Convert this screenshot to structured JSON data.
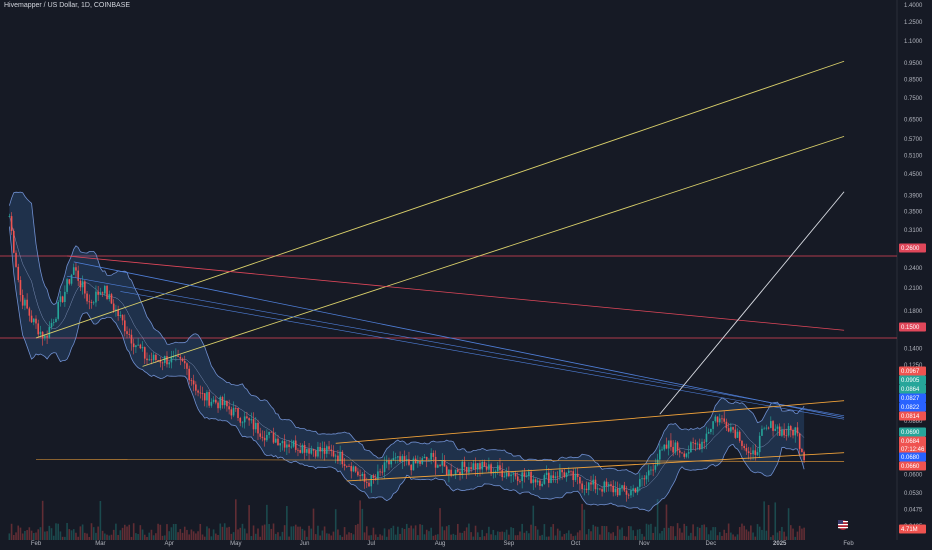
{
  "header": {
    "title": "Hivemapper / US Dollar, 1D, COINBASE"
  },
  "colors": {
    "background": "#161a25",
    "up": "#26a69a",
    "down": "#ef5350",
    "band_fill": "#3b6fb0",
    "band_line": "#6f8fd0",
    "trend_yellow": "#d9cf6a",
    "trend_orange": "#f0a23a",
    "trend_blue": "#4f7fd8",
    "trend_red": "#e0475a",
    "trend_white": "#d8dbe2",
    "axis_text": "#b2b5be"
  },
  "chart_data": {
    "type": "candlestick",
    "title": "Hivemapper / US Dollar, 1D, COINBASE",
    "y_scale": "log",
    "y_ticks": [
      "1.4000",
      "1.2500",
      "1.1000",
      "0.9500",
      "0.8500",
      "0.7500",
      "0.6500",
      "0.5700",
      "0.5100",
      "0.4500",
      "0.3900",
      "0.3500",
      "0.3100",
      "0.2700",
      "0.2400",
      "0.2100",
      "0.1800",
      "0.1600",
      "0.1400",
      "0.1250",
      "0.1100",
      "0.0960",
      "0.0860",
      "0.0760",
      "0.0680",
      "0.0600",
      "0.0530",
      "0.0475",
      "0.0425"
    ],
    "x_ticks": [
      "Feb",
      "Mar",
      "Apr",
      "May",
      "Jun",
      "Jul",
      "Aug",
      "Sep",
      "Oct",
      "Nov",
      "Dec",
      "2025",
      "Feb"
    ],
    "price_path": [
      {
        "date": "2024-01-20",
        "price": 0.34
      },
      {
        "date": "2024-01-25",
        "price": 0.2
      },
      {
        "date": "2024-01-30",
        "price": 0.17
      },
      {
        "date": "2024-02-05",
        "price": 0.15
      },
      {
        "date": "2024-02-12",
        "price": 0.19
      },
      {
        "date": "2024-02-18",
        "price": 0.24
      },
      {
        "date": "2024-02-25",
        "price": 0.19
      },
      {
        "date": "2024-03-02",
        "price": 0.21
      },
      {
        "date": "2024-03-08",
        "price": 0.18
      },
      {
        "date": "2024-03-15",
        "price": 0.15
      },
      {
        "date": "2024-03-22",
        "price": 0.13
      },
      {
        "date": "2024-04-01",
        "price": 0.13
      },
      {
        "date": "2024-04-08",
        "price": 0.125
      },
      {
        "date": "2024-04-15",
        "price": 0.102
      },
      {
        "date": "2024-04-25",
        "price": 0.096
      },
      {
        "date": "2024-05-05",
        "price": 0.087
      },
      {
        "date": "2024-05-15",
        "price": 0.078
      },
      {
        "date": "2024-05-25",
        "price": 0.074
      },
      {
        "date": "2024-06-05",
        "price": 0.071
      },
      {
        "date": "2024-06-15",
        "price": 0.069
      },
      {
        "date": "2024-06-22",
        "price": 0.064
      },
      {
        "date": "2024-06-28",
        "price": 0.057
      },
      {
        "date": "2024-07-03",
        "price": 0.058
      },
      {
        "date": "2024-07-10",
        "price": 0.066
      },
      {
        "date": "2024-07-20",
        "price": 0.064
      },
      {
        "date": "2024-07-28",
        "price": 0.067
      },
      {
        "date": "2024-08-05",
        "price": 0.061
      },
      {
        "date": "2024-08-15",
        "price": 0.064
      },
      {
        "date": "2024-08-25",
        "price": 0.062
      },
      {
        "date": "2024-09-05",
        "price": 0.06
      },
      {
        "date": "2024-09-15",
        "price": 0.058
      },
      {
        "date": "2024-09-25",
        "price": 0.061
      },
      {
        "date": "2024-10-05",
        "price": 0.056
      },
      {
        "date": "2024-10-15",
        "price": 0.055
      },
      {
        "date": "2024-10-25",
        "price": 0.053
      },
      {
        "date": "2024-11-01",
        "price": 0.058
      },
      {
        "date": "2024-11-06",
        "price": 0.066
      },
      {
        "date": "2024-11-12",
        "price": 0.073
      },
      {
        "date": "2024-11-20",
        "price": 0.07
      },
      {
        "date": "2024-11-27",
        "price": 0.075
      },
      {
        "date": "2024-12-03",
        "price": 0.088
      },
      {
        "date": "2024-12-08",
        "price": 0.085
      },
      {
        "date": "2024-12-14",
        "price": 0.078
      },
      {
        "date": "2024-12-19",
        "price": 0.066
      },
      {
        "date": "2024-12-24",
        "price": 0.078
      },
      {
        "date": "2024-12-29",
        "price": 0.084
      },
      {
        "date": "2025-01-03",
        "price": 0.079
      },
      {
        "date": "2025-01-08",
        "price": 0.081
      },
      {
        "date": "2025-01-12",
        "price": 0.0684
      }
    ],
    "price_labels": [
      {
        "text": "0.2600",
        "color": "#e0475a"
      },
      {
        "text": "0.1500",
        "color": "#e0475a"
      },
      {
        "text": "0.0967",
        "color": "#ef5350"
      },
      {
        "text": "0.0905",
        "color": "#26a69a"
      },
      {
        "text": "0.0864",
        "color": "#26a69a"
      },
      {
        "text": "0.0827",
        "color": "#2962ff"
      },
      {
        "text": "0.0822",
        "color": "#2962ff"
      },
      {
        "text": "0.0814",
        "color": "#ef5350"
      },
      {
        "text": "0.0690",
        "color": "#26a69a"
      },
      {
        "text": "0.0684",
        "color": "#ef5350"
      },
      {
        "text": "07:12:46",
        "color": "#ef5350"
      },
      {
        "text": "0.0680",
        "color": "#2962ff"
      },
      {
        "text": "0.0660",
        "color": "#ef5350"
      },
      {
        "text": "4.71M",
        "color": "#ef5350"
      }
    ],
    "horizontal_levels": [
      0.26,
      0.15
    ],
    "grid": false,
    "legend": "none"
  }
}
